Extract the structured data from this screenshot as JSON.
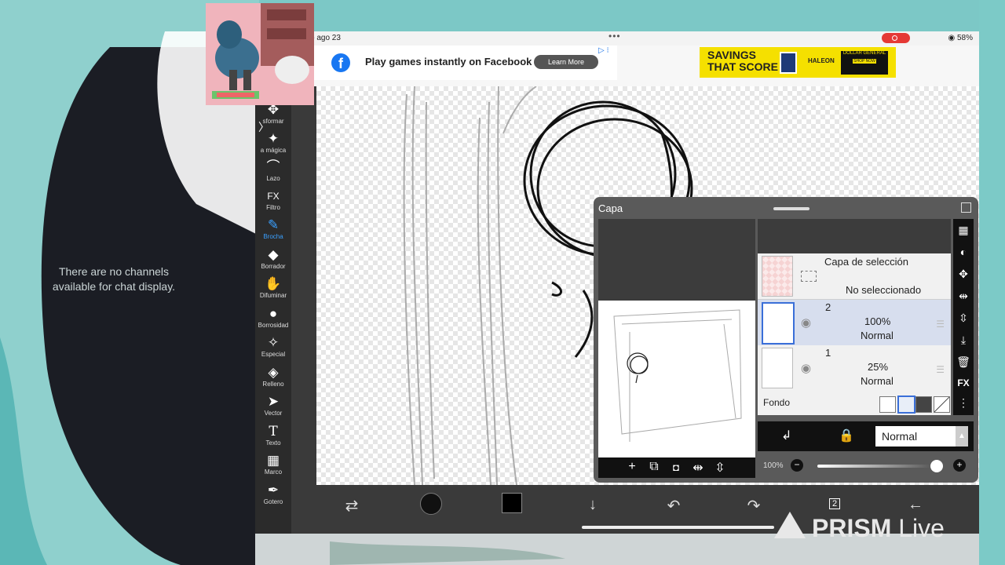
{
  "status_bar": {
    "date": "b ago 23",
    "menu": "•••",
    "battery": "58%"
  },
  "ad_facebook": {
    "text": "Play games instantly on Facebook",
    "button": "Learn More",
    "logo": "f"
  },
  "ad_savings": {
    "title_line1": "SAVINGS",
    "title_line2": "THAT SCORE",
    "brand": "HALEON",
    "badge": "DOLLAR GENERAL",
    "shop": "SHOP NOW"
  },
  "tools": [
    {
      "label": "sformar",
      "icon": "✥"
    },
    {
      "label": "a mágica",
      "icon": "✦"
    },
    {
      "label": "Lazo",
      "icon": "⌒"
    },
    {
      "label": "Filtro",
      "icon": "FX"
    },
    {
      "label": "Brocha",
      "icon": "✎"
    },
    {
      "label": "Borrador",
      "icon": "◆"
    },
    {
      "label": "Difuminar",
      "icon": "✋"
    },
    {
      "label": "Borrosidad",
      "icon": "●"
    },
    {
      "label": "Especial",
      "icon": "✧"
    },
    {
      "label": "Relleno",
      "icon": "◈"
    },
    {
      "label": "Vector",
      "icon": "➤"
    },
    {
      "label": "Texto",
      "icon": "T"
    },
    {
      "label": "Marco",
      "icon": "▦"
    },
    {
      "label": "Gotero",
      "icon": "✒"
    }
  ],
  "layer_panel": {
    "title": "Capa",
    "selection_layer": {
      "title": "Capa de selección",
      "status": "No seleccionado"
    },
    "layers": [
      {
        "name": "2",
        "opacity": "100%",
        "mode": "Normal"
      },
      {
        "name": "1",
        "opacity": "25%",
        "mode": "Normal"
      }
    ],
    "background_label": "Fondo",
    "blend_mode": "Normal",
    "opacity_label": "100%"
  },
  "bottom_bar": {
    "layers_count": "2"
  },
  "side_text": {
    "no_channels": "There are no channels available for chat display."
  },
  "watermark": {
    "brand": "PRISM",
    "suffix": "Live"
  }
}
